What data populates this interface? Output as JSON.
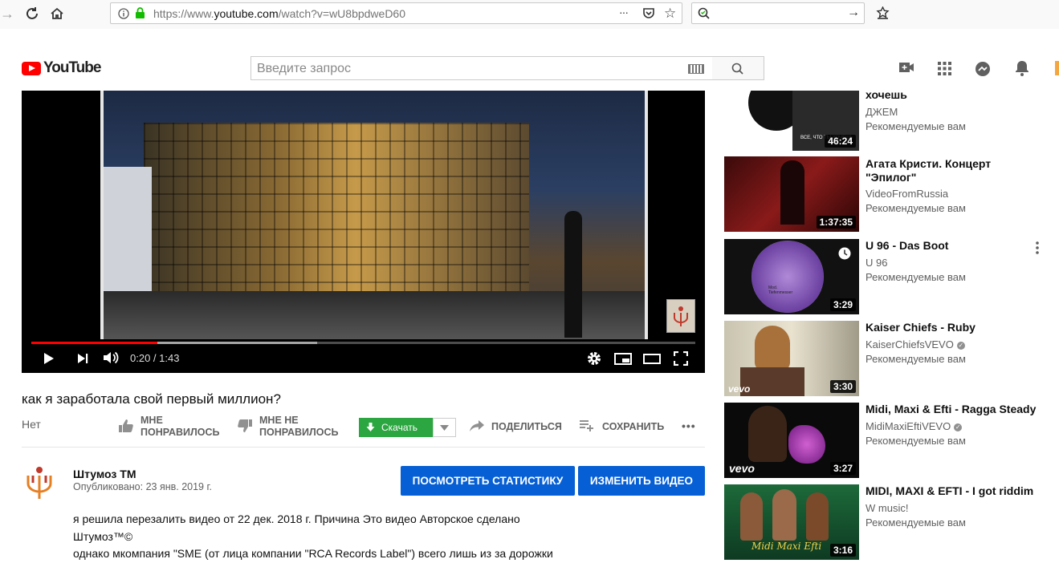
{
  "browser": {
    "url_prefix": "https://www.",
    "url_domain": "youtube.com",
    "url_path": "/watch?v=wU8bpdweD60",
    "more_icon": "···"
  },
  "header": {
    "logo_text": "YouTube",
    "search_placeholder": "Введите запрос"
  },
  "player": {
    "time": "0:20 / 1:43",
    "progress": 0.19,
    "buffered": 0.43
  },
  "video": {
    "title": "как я заработала свой первый миллион?",
    "views": "Нет",
    "like_label_1": "МНЕ",
    "like_label_2": "ПОНРАВИЛОСЬ",
    "dislike_label_1": "МНЕ НЕ",
    "dislike_label_2": "ПОНРАВИЛОСЬ",
    "download_label": "Скачать",
    "share_label": "ПОДЕЛИТЬСЯ",
    "save_label": "СОХРАНИТЬ",
    "more_label": "•••"
  },
  "channel": {
    "name": "Штумоз ТМ",
    "published": "Опубликовано: 23 янв. 2019 г.",
    "stats_button": "ПОСМОТРЕТЬ СТАТИСТИКУ",
    "edit_button": "ИЗМЕНИТЬ ВИДЕО",
    "description": [
      "я решила перезалить видео от 22 дек. 2018 г. Причина Это видео Авторское сделано",
      "Штумоз™©",
      "однако мкомпания \"SME (от лица компании \"RCA Records Label\") всего лишь из за дорожки"
    ]
  },
  "sidebar": [
    {
      "title_lines": [
        "хочешь"
      ],
      "channel": "ДЖЕМ",
      "verified": false,
      "rec": "Рекомендуемые вам",
      "duration": "46:24"
    },
    {
      "title_lines": [
        "Агата Кристи. Концерт",
        "\"Эпилог\""
      ],
      "channel": "VideoFromRussia",
      "verified": false,
      "rec": "Рекомендуемые вам",
      "duration": "1:37:35"
    },
    {
      "title_lines": [
        "U 96 - Das Boot"
      ],
      "channel": "U 96",
      "verified": false,
      "rec": "Рекомендуемые вам",
      "duration": "3:29"
    },
    {
      "title_lines": [
        "Kaiser Chiefs - Ruby"
      ],
      "channel": "KaiserChiefsVEVO",
      "verified": true,
      "rec": "Рекомендуемые вам",
      "duration": "3:30"
    },
    {
      "title_lines": [
        "Midi, Maxi & Efti - Ragga Steady"
      ],
      "channel": "MidiMaxiEftiVEVO",
      "verified": true,
      "rec": "Рекомендуемые вам",
      "duration": "3:27"
    },
    {
      "title_lines": [
        "MIDI, MAXI & EFTI - I got riddim"
      ],
      "channel": "W music!",
      "verified": false,
      "rec": "Рекомендуемые вам",
      "duration": "3:16"
    }
  ],
  "sidebar_thumb_labels": {
    "vevo_1": "vevo",
    "vevo_2": "vevo",
    "album_1": "ВСЕ, ЧТО ТЫ ХОЧЕШЬ",
    "album_6": "Midi Maxi Efti",
    "u96_text": "Mod. Tiefenmesser"
  },
  "colors": {
    "yt_red": "#ff0000",
    "primary_blue": "#065fd4",
    "download_green": "#2ba640"
  }
}
